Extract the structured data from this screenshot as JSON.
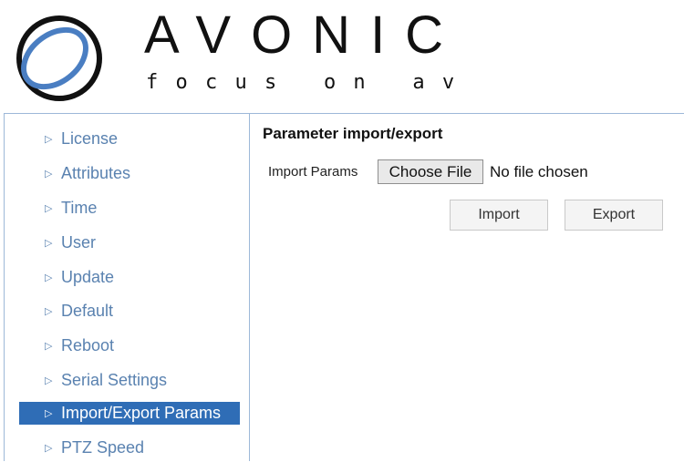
{
  "brand": {
    "name": "AVONIC",
    "tagline": "f o c u s   o n   a v"
  },
  "sidebar": {
    "items": [
      {
        "label": "License",
        "active": false
      },
      {
        "label": "Attributes",
        "active": false
      },
      {
        "label": "Time",
        "active": false
      },
      {
        "label": "User",
        "active": false
      },
      {
        "label": "Update",
        "active": false
      },
      {
        "label": "Default",
        "active": false
      },
      {
        "label": "Reboot",
        "active": false
      },
      {
        "label": "Serial Settings",
        "active": false
      },
      {
        "label": "Import/Export Params",
        "active": true
      },
      {
        "label": "PTZ Speed",
        "active": false
      }
    ],
    "arrow_glyph": "▷"
  },
  "main": {
    "title": "Parameter import/export",
    "import_label": "Import Params",
    "choose_file_label": "Choose File",
    "file_status": "No file chosen",
    "import_button": "Import",
    "export_button": "Export"
  },
  "colors": {
    "accent": "#2f6db6",
    "menu_text": "#5a82b0",
    "border": "#9db8d8"
  }
}
